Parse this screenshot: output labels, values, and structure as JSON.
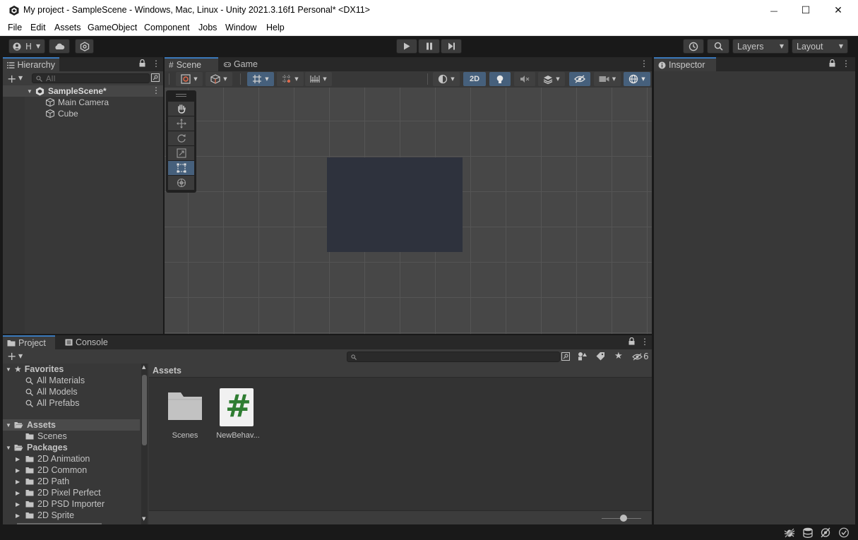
{
  "window": {
    "title": "My project - SampleScene - Windows, Mac, Linux - Unity 2021.3.16f1 Personal* <DX11>",
    "minimize": "—",
    "maximize": "☐",
    "close": "✕"
  },
  "menu": [
    "File",
    "Edit",
    "Assets",
    "GameObject",
    "Component",
    "Jobs",
    "Window",
    "Help"
  ],
  "toolbar": {
    "account_label": "H",
    "layers_label": "Layers",
    "layout_label": "Layout"
  },
  "hierarchy": {
    "tab": "Hierarchy",
    "search_placeholder": "All",
    "scene_name": "SampleScene*",
    "objects": [
      "Main Camera",
      "Cube"
    ]
  },
  "scene_view": {
    "tabs": [
      "Scene",
      "Game"
    ],
    "mode_2d": "2D"
  },
  "inspector": {
    "tab": "Inspector"
  },
  "project": {
    "tabs": [
      "Project",
      "Console"
    ],
    "hidden_count": "6",
    "favorites_label": "Favorites",
    "favorites": [
      "All Materials",
      "All Models",
      "All Prefabs"
    ],
    "assets_label": "Assets",
    "asset_folders": [
      "Scenes"
    ],
    "packages_label": "Packages",
    "packages": [
      "2D Animation",
      "2D Common",
      "2D Path",
      "2D Pixel Perfect",
      "2D PSD Importer",
      "2D Sprite"
    ],
    "breadcrumb": "Assets",
    "grid_items": [
      {
        "name": "Scenes",
        "icon": "folder-icon"
      },
      {
        "name": "NewBehav...",
        "icon": "csharp-script-icon"
      }
    ]
  },
  "colors": {
    "accent": "#3a79bb",
    "panel": "#383838",
    "scene_grid": "#474747",
    "cube": "#2e323d",
    "selected_tool": "#46607c"
  }
}
